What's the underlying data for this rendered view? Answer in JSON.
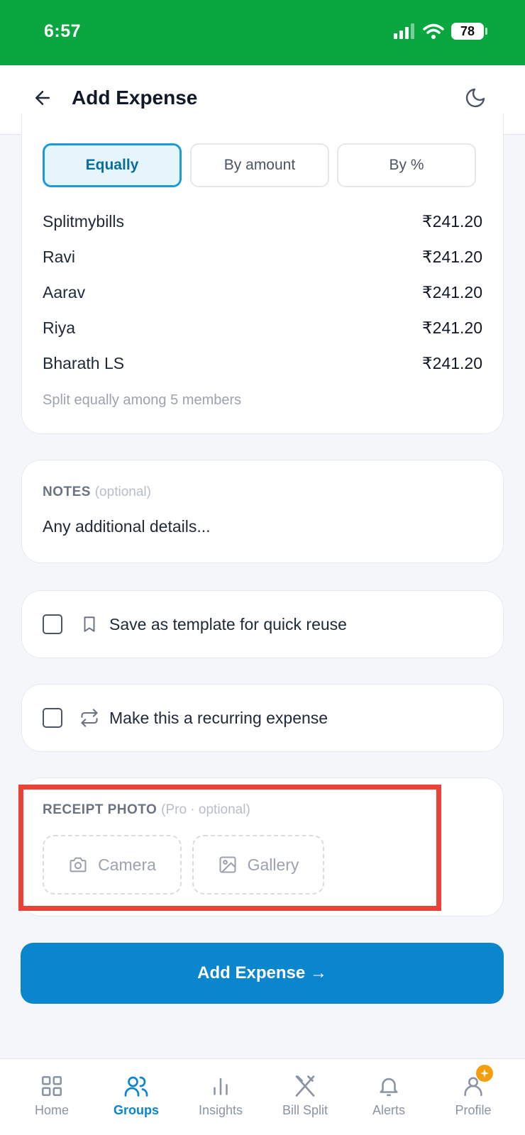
{
  "status_bar": {
    "time": "6:57",
    "battery": "78"
  },
  "header": {
    "title": "Add Expense"
  },
  "split": {
    "modes": [
      {
        "label": "Equally",
        "active": true
      },
      {
        "label": "By amount",
        "active": false
      },
      {
        "label": "By %",
        "active": false
      }
    ],
    "members": [
      {
        "name": "Splitmybills",
        "amount": "₹241.20"
      },
      {
        "name": "Ravi",
        "amount": "₹241.20"
      },
      {
        "name": "Aarav",
        "amount": "₹241.20"
      },
      {
        "name": "Riya",
        "amount": "₹241.20"
      },
      {
        "name": "Bharath LS",
        "amount": "₹241.20"
      }
    ],
    "note": "Split equally among 5 members"
  },
  "notes": {
    "label": "NOTES",
    "optional": "(optional)",
    "placeholder": "Any additional details..."
  },
  "options": {
    "template_label": "Save as template for quick reuse",
    "template_checked": false,
    "recurring_label": "Make this a recurring expense",
    "recurring_checked": false
  },
  "receipt": {
    "label": "RECEIPT PHOTO",
    "optional": "(Pro · optional)",
    "camera_label": "Camera",
    "gallery_label": "Gallery"
  },
  "submit": {
    "label": "Add Expense →"
  },
  "tabs": [
    {
      "label": "Home",
      "icon": "grid-icon",
      "active": false
    },
    {
      "label": "Groups",
      "icon": "users-icon",
      "active": true
    },
    {
      "label": "Insights",
      "icon": "bar-chart-icon",
      "active": false
    },
    {
      "label": "Bill Split",
      "icon": "utensils-icon",
      "active": false
    },
    {
      "label": "Alerts",
      "icon": "bell-icon",
      "active": false
    },
    {
      "label": "Profile",
      "icon": "user-icon",
      "active": false
    }
  ],
  "colors": {
    "status_bar": "#0aa640",
    "accent": "#0a86cf",
    "highlight": "#ea4335",
    "pro_badge": "#f59e0b"
  }
}
